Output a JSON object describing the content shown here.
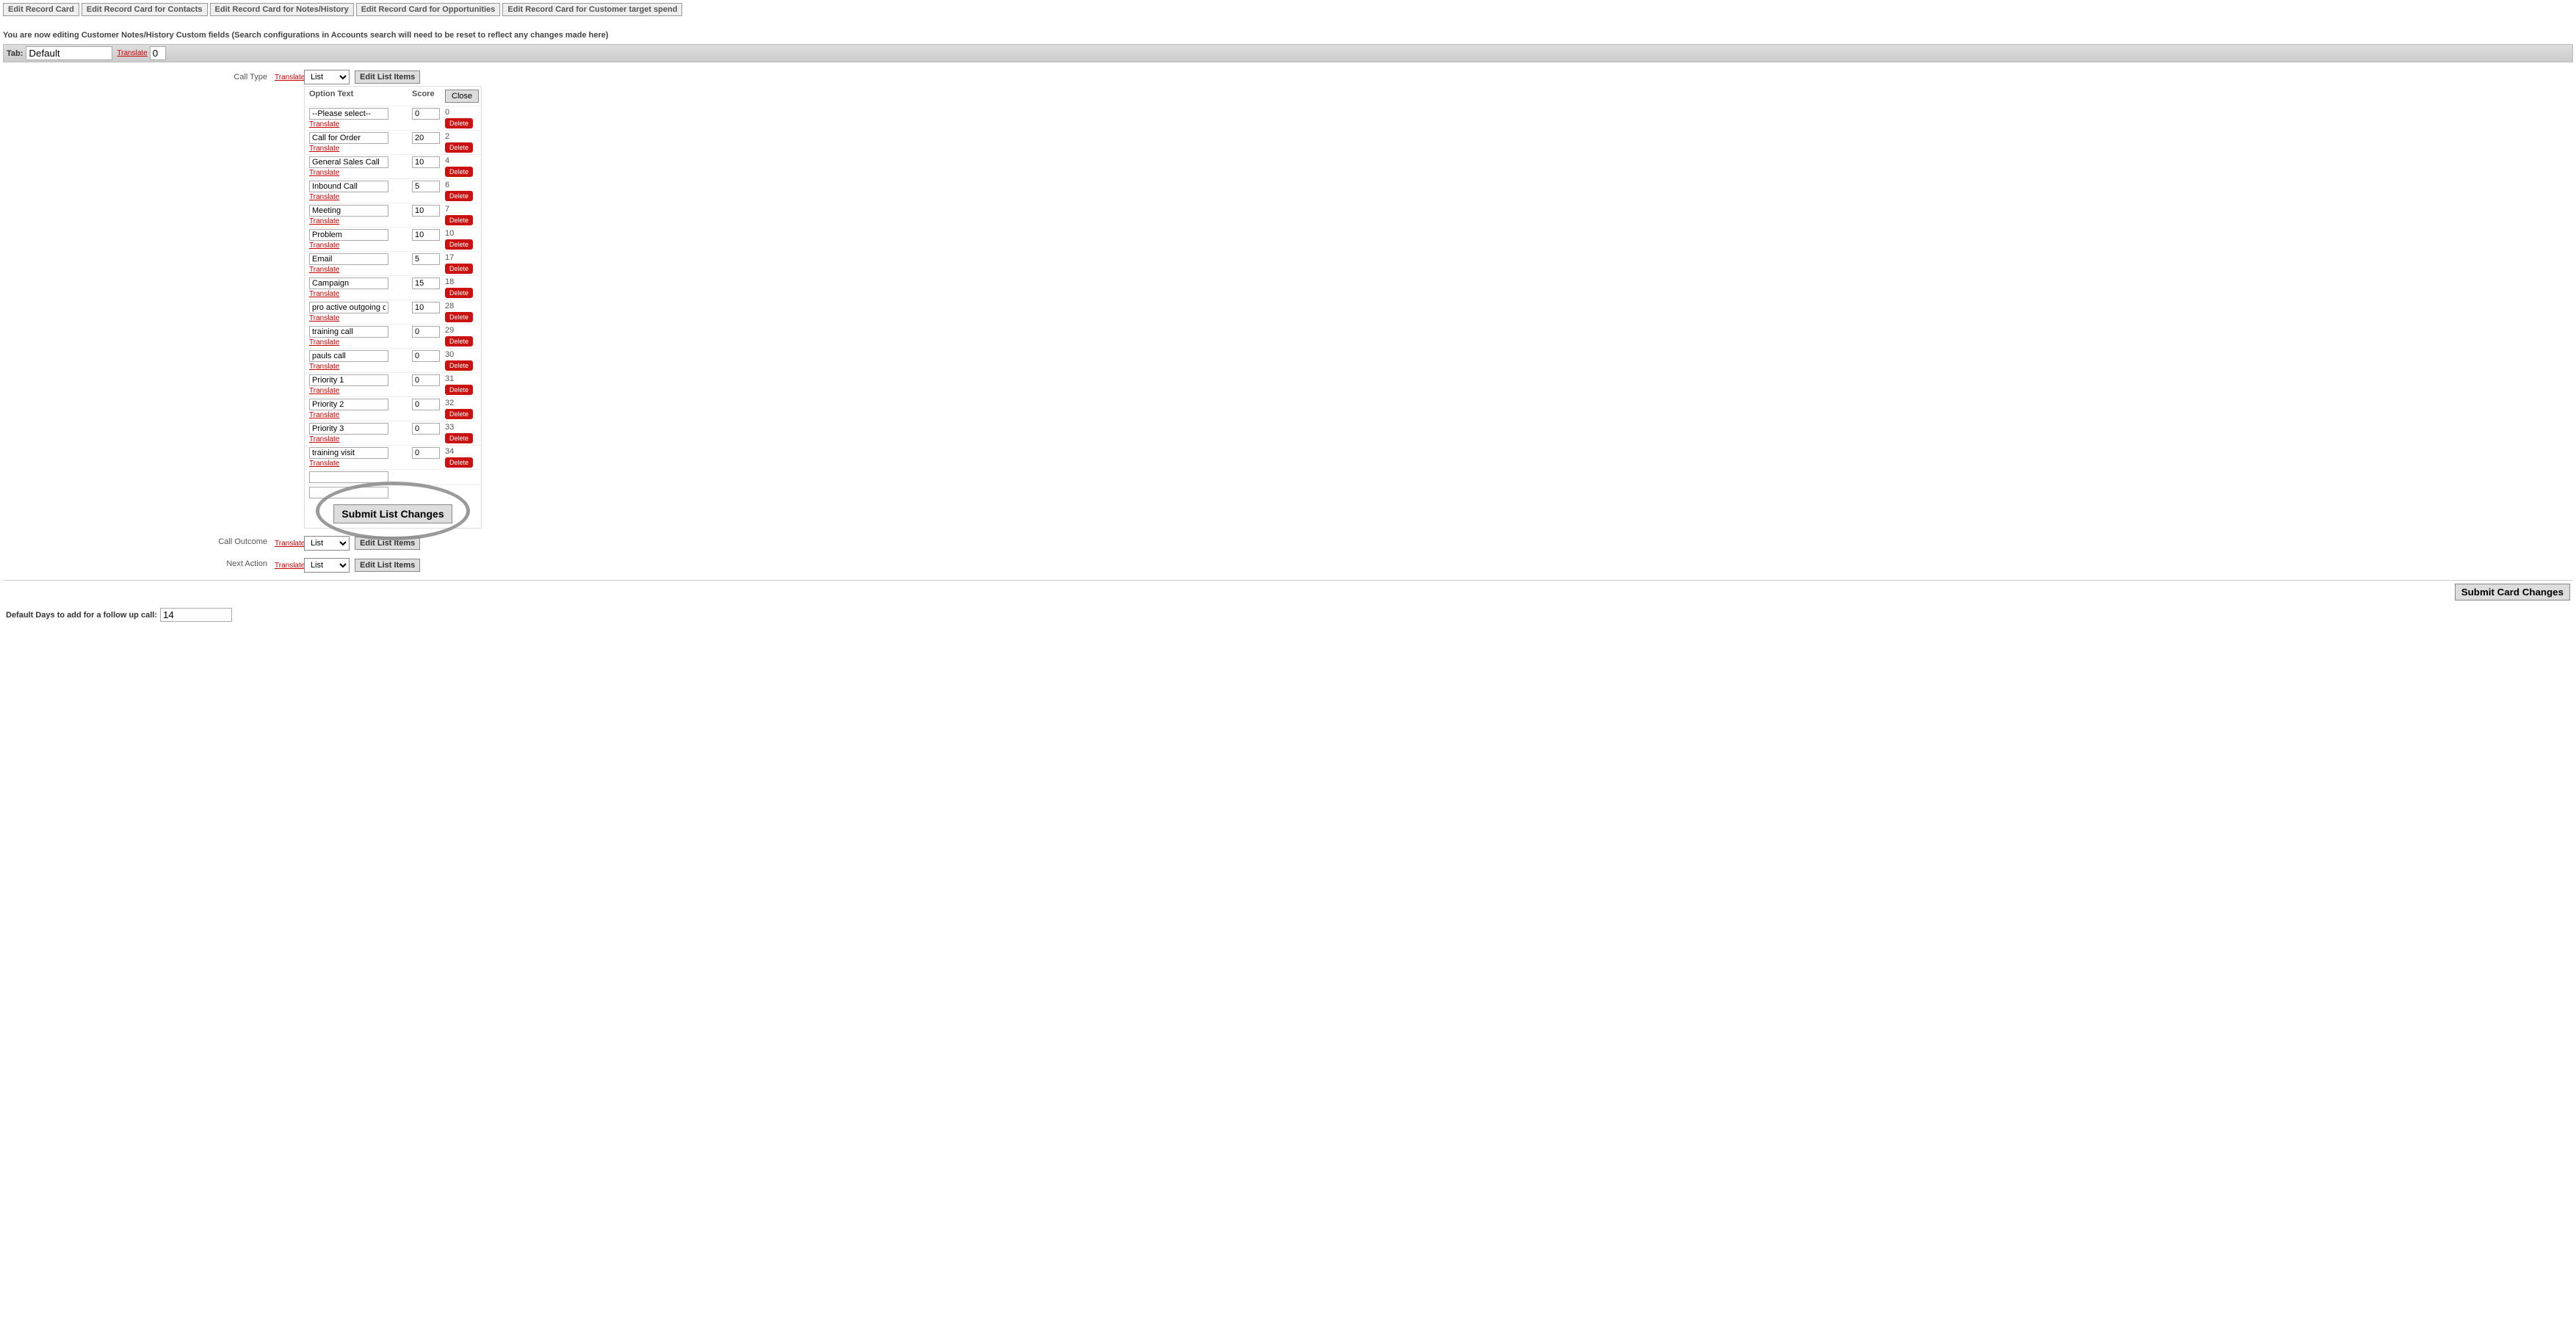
{
  "top_tabs": [
    "Edit Record Card",
    "Edit Record Card for Contacts",
    "Edit Record Card for Notes/History",
    "Edit Record Card for Opportunities",
    "Edit Record Card for Customer target spend"
  ],
  "info_text": "You are now editing Customer Notes/History Custom fields (Search configurations in Accounts search will need to be reset to reflect any changes made here)",
  "tabbar": {
    "label": "Tab:",
    "name_value": "Default",
    "translate_label": "Translate",
    "number_value": "0"
  },
  "submit_card_label": "Submit Card Changes",
  "default_days": {
    "label": "Default Days to add for a follow up call:",
    "value": "14"
  },
  "fields": {
    "call_type": {
      "label": "Call Type",
      "translate_label": "Translate",
      "type_value": "List",
      "edit_button": "Edit List Items",
      "header_option": "Option Text",
      "header_score": "Score",
      "close_label": "Close",
      "delete_label": "Delete",
      "submit_label": "Submit List Changes",
      "translate_row_label": "Translate",
      "items": [
        {
          "text": "--Please select--",
          "score": "0",
          "id": "0"
        },
        {
          "text": "Call for Order",
          "score": "20",
          "id": "2"
        },
        {
          "text": "General Sales Call",
          "score": "10",
          "id": "4"
        },
        {
          "text": "Inbound Call",
          "score": "5",
          "id": "6"
        },
        {
          "text": "Meeting",
          "score": "10",
          "id": "7"
        },
        {
          "text": "Problem",
          "score": "10",
          "id": "10"
        },
        {
          "text": "Email",
          "score": "5",
          "id": "17"
        },
        {
          "text": "Campaign",
          "score": "15",
          "id": "18"
        },
        {
          "text": "pro active outgoing call",
          "score": "10",
          "id": "28"
        },
        {
          "text": "training call",
          "score": "0",
          "id": "29"
        },
        {
          "text": "pauls call",
          "score": "0",
          "id": "30"
        },
        {
          "text": "Priority 1",
          "score": "0",
          "id": "31"
        },
        {
          "text": "Priority 2",
          "score": "0",
          "id": "32"
        },
        {
          "text": "Priority 3",
          "score": "0",
          "id": "33"
        },
        {
          "text": "training visit",
          "score": "0",
          "id": "34"
        }
      ]
    },
    "call_outcome": {
      "label": "Call Outcome",
      "translate_label": "Translate",
      "type_value": "List",
      "edit_button": "Edit List Items"
    },
    "next_action": {
      "label": "Next Action",
      "translate_label": "Translate",
      "type_value": "List",
      "edit_button": "Edit List Items"
    }
  }
}
